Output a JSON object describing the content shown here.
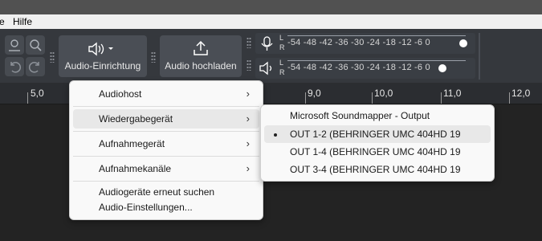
{
  "menubar": {
    "items": [
      "e",
      "Hilfe"
    ]
  },
  "toolbar": {
    "audio_setup_label": "Audio-Einrichtung",
    "upload_label": "Audio hochladen"
  },
  "meters": {
    "scale": "-54 -48 -42 -36 -30 -24 -18 -12  -6   0",
    "l": "L",
    "r": "R",
    "playback_level": 1.0,
    "record_level": 0.88
  },
  "ruler": {
    "labels": [
      "5,0",
      "9,0",
      "10,0",
      "11,0",
      "12,0"
    ]
  },
  "menu": {
    "items": [
      {
        "label": "Audiohost",
        "submenu": true
      },
      {
        "label": "Wiedergabegerät",
        "submenu": true
      },
      {
        "label": "Aufnahmegerät",
        "submenu": true
      },
      {
        "label": "Aufnahmekanäle",
        "submenu": true
      },
      {
        "label": "Audiogeräte erneut suchen",
        "submenu": false
      },
      {
        "label": "Audio-Einstellungen...",
        "submenu": false
      }
    ],
    "arrow": "›"
  },
  "submenu": {
    "items": [
      {
        "label": "Microsoft Soundmapper - Output",
        "selected": false
      },
      {
        "label": "OUT 1-2 (BEHRINGER UMC 404HD 19",
        "selected": true
      },
      {
        "label": "OUT 1-4 (BEHRINGER UMC 404HD 19",
        "selected": false
      },
      {
        "label": "OUT 3-4 (BEHRINGER UMC 404HD 19",
        "selected": false
      }
    ]
  }
}
